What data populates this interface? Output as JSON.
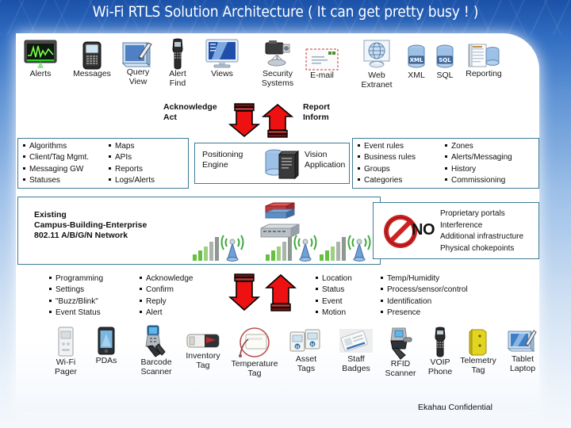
{
  "slide": {
    "title": "Wi-Fi RTLS Solution Architecture ( It can get pretty busy ! )",
    "footer": "Ekahau Confidential",
    "accent_border": "#3d7b96",
    "arrow_color": "#ee1111",
    "title_band_color": "#1b52a8"
  },
  "top_icons": [
    {
      "label": "Alerts",
      "icon": "alerts-monitor-icon"
    },
    {
      "label": "Messages",
      "icon": "blackberry-phone-icon"
    },
    {
      "label": "Query\nView",
      "icon": "query-view-screen-icon"
    },
    {
      "label": "Alert\nFind",
      "icon": "handset-phone-icon"
    },
    {
      "label": "Views",
      "icon": "monitor-icon"
    },
    {
      "label": "Security\nSystems",
      "icon": "security-camera-icon"
    },
    {
      "label": "E-mail",
      "icon": "envelope-icon"
    },
    {
      "label": "Web\nExtranet",
      "icon": "web-globe-icon"
    },
    {
      "label": "XML",
      "icon": "xml-database-icon"
    },
    {
      "label": "SQL",
      "icon": "sql-database-icon"
    },
    {
      "label": "Reporting",
      "icon": "reporting-database-icon"
    }
  ],
  "flow_upper": {
    "left_label": "Acknowledge\nAct",
    "right_label": "Report\nInform",
    "down_arrow": "down-arrow-icon",
    "up_arrow": "up-arrow-icon"
  },
  "flow_lower": {
    "down_arrow": "down-arrow-icon",
    "up_arrow": "up-arrow-icon"
  },
  "platform_row": {
    "left_box": {
      "col1": [
        "Algorithms",
        "Client/Tag Mgmt.",
        "Messaging GW",
        "Statuses"
      ],
      "col2": [
        "Maps",
        "APIs",
        "Reports",
        "Logs/Alerts"
      ]
    },
    "engine_box": {
      "left_label": "Positioning\nEngine",
      "server_icon": "server-tower-icon",
      "right_label": "Vision\nApplication"
    },
    "right_box": {
      "col1": [
        "Event rules",
        "Business rules",
        "Groups",
        "Categories"
      ],
      "col2": [
        "Zones",
        "Alerts/Messaging",
        "History",
        "Commissioning"
      ]
    }
  },
  "network_row": {
    "network_box": {
      "text": "Existing\nCampus-Building-Enterprise\n 802.11 A/B/G/N Network",
      "icons": [
        "switch-stack-icon",
        "network-switch-icon",
        "signal-bars-icon",
        "access-point-icon"
      ]
    },
    "no_box": {
      "symbol": "prohibited-icon",
      "word": "NO",
      "items": [
        "Proprietary portals",
        "Interference",
        "Additional infrastructure",
        "Physical chokepoints"
      ]
    }
  },
  "tag_row": {
    "col1": [
      "Programming",
      "Settings",
      "\"Buzz/Blink\"",
      "Event Status"
    ],
    "col2": [
      "Acknowledge",
      "Confirm",
      "Reply",
      "Alert"
    ],
    "col3": [
      "Location",
      "Status",
      "Event",
      "Motion"
    ],
    "col4": [
      "Temp/Humidity",
      "Process/sensor/control",
      "Identification",
      "Presence"
    ]
  },
  "device_icons": [
    {
      "label": "Wi-Fi\nPager",
      "icon": "wifi-pager-icon"
    },
    {
      "label": "PDAs",
      "icon": "pda-icon"
    },
    {
      "label": "Barcode\nScanner",
      "icon": "barcode-scanner-icon"
    },
    {
      "label": "Inventory\nTag",
      "icon": "inventory-tag-icon"
    },
    {
      "label": "Temperature\nTag",
      "icon": "temperature-tag-icon"
    },
    {
      "label": "Asset\nTags",
      "icon": "asset-tags-icon"
    },
    {
      "label": "Staff\nBadges",
      "icon": "staff-badge-icon"
    },
    {
      "label": "RFID\nScanner",
      "icon": "rfid-scanner-icon"
    },
    {
      "label": "VOIP\nPhone",
      "icon": "voip-phone-icon"
    },
    {
      "label": "Telemetry\nTag",
      "icon": "telemetry-tag-icon"
    },
    {
      "label": "Tablet\nLaptop",
      "icon": "tablet-laptop-icon"
    }
  ]
}
